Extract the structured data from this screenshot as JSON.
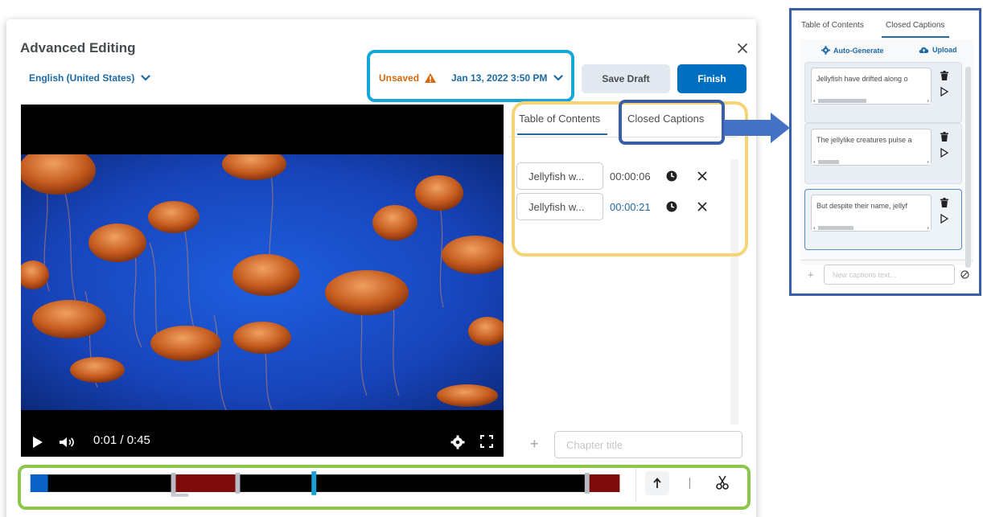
{
  "dialog": {
    "title": "Advanced Editing",
    "language": "English (United States)",
    "status": "Unsaved",
    "datetime": "Jan 13, 2022 3:50 PM",
    "save_draft": "Save Draft",
    "finish": "Finish"
  },
  "player": {
    "time": "0:01 / 0:45"
  },
  "side_panel": {
    "tabs": [
      "Table of Contents",
      "Closed Captions"
    ],
    "active_tab": "Table of Contents",
    "chapters": [
      {
        "title": "Jellyfish w...",
        "time": "00:00:06"
      },
      {
        "title": "Jellyfish w...",
        "time": "00:00:21"
      }
    ],
    "chapter_placeholder": "Chapter title"
  },
  "timeline": {
    "playhead_fraction": 0.49,
    "colors": {
      "played": "#0a62c7",
      "cut": "#7e0a0a",
      "track": "#000000",
      "playhead": "#1a9fd4"
    }
  },
  "zoom_panel": {
    "tabs": [
      "Table of Contents",
      "Closed Captions"
    ],
    "active_tab": "Closed Captions",
    "auto_generate": "Auto-Generate",
    "upload": "Upload",
    "captions": [
      "Jellyfish have drifted along o",
      "The jellylike creatures pulse a",
      "But despite their name, jellyf"
    ],
    "new_caption_placeholder": "New captions text..."
  },
  "annotation_colors": {
    "blue": "#16a6d9",
    "yellow": "#f5d476",
    "navy": "#3a5ea9",
    "green": "#8cc64b"
  }
}
